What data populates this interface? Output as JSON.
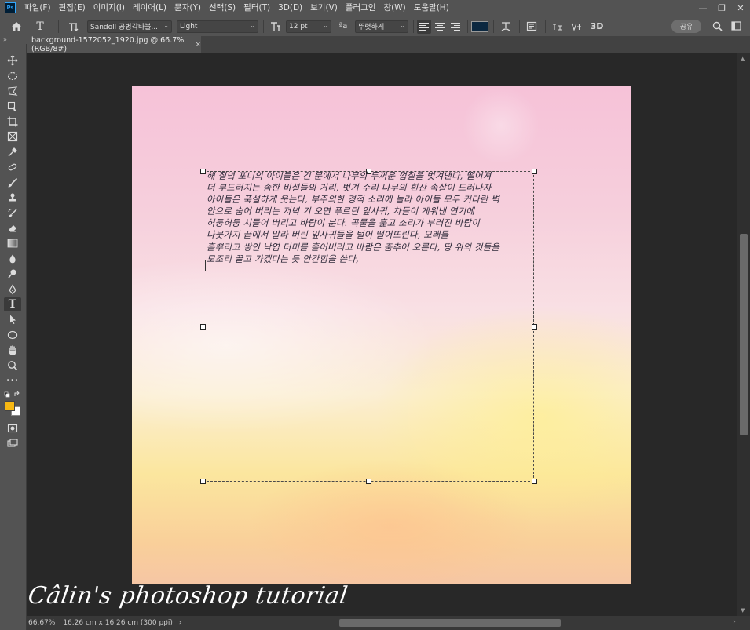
{
  "menubar": {
    "logo": "Ps",
    "items": [
      "파일(F)",
      "편집(E)",
      "이미지(I)",
      "레이어(L)",
      "문자(Y)",
      "선택(S)",
      "필터(T)",
      "3D(D)",
      "보기(V)",
      "플러그인",
      "창(W)",
      "도움말(H)"
    ],
    "window_controls": [
      "—",
      "❐",
      "✕"
    ]
  },
  "options": {
    "font_family": "Sandoll 공병각타블...",
    "font_style": "Light",
    "font_size": "12 pt",
    "antialias_label": "ªa",
    "antialias": "뚜렷하게",
    "text_color": "#0c2840",
    "share_label": "공유",
    "icons": [
      "home-icon",
      "type-tool-icon",
      "orientation-toggle-icon",
      "font-size-icon",
      "antialias-icon",
      "align-left-icon",
      "align-center-icon",
      "align-right-icon",
      "warp-text-icon",
      "character-panel-icon",
      "3d-icon",
      "search-icon",
      "workspace-icon"
    ]
  },
  "panel_strip": "»",
  "document": {
    "tab_title": "background-1572052_1920.jpg @ 66.7% (RGB/8#)",
    "close": "×"
  },
  "canvas": {
    "text_lines": [
      "해 질녘 포니의 아이들은 긴 문에서 나무의 두꺼운 껍질을 벗겨낸다, 떨어져",
      "더 부드러지는 솜한 비설들의 거리, 벗겨 수리 나무의 흰산 속살이 드러나자",
      "아이들은 푹설하게 웃는다, 부주의한 경적 소리에 놀라 아이들 모두 커다란 벽",
      "안으로 숨어 버리는 저녁 기 오면 푸르던 잎사귀, 차들이 게워낸 연기에",
      "허둥허둥 시들어 버리고 바람이 분다. 곡물을 훑고 소리가 부러진 바람이",
      "나뭇가지 끝에서 말라 버린 잎사귀들을 털어 떨어뜨린다, 모래를",
      "흩뿌리고 쌓인 낙엽 더미를 흩어버리고 바람은 춤추어 오른다, 땅 위의 것들을",
      "모조리 끌고 가겠다는 듯 안간힘을 쓴다,"
    ],
    "watermark": "Câlin's photoshop tutorial"
  },
  "status": {
    "zoom": "66.67%",
    "doc_info": "16.26 cm x 16.26 cm (300 ppi)",
    "arrow": "›",
    "scroll_left": "‹",
    "scroll_right": "›"
  },
  "colors": {
    "foreground": "#f7b813",
    "background": "#ffffff"
  }
}
